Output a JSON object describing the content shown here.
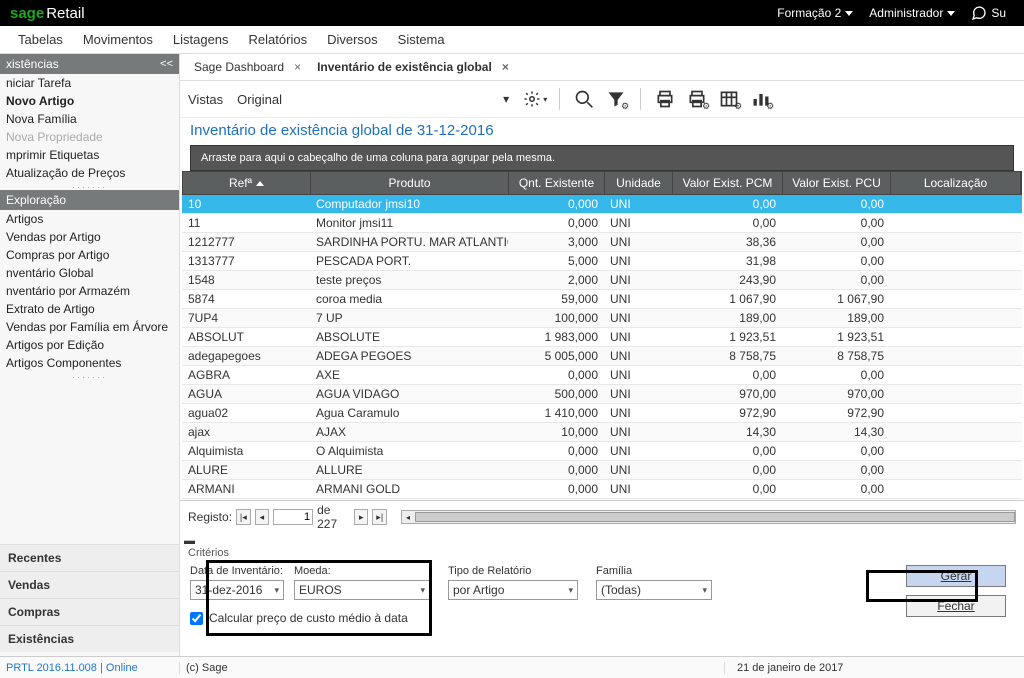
{
  "brand": {
    "sage": "sage",
    "retail": "Retail"
  },
  "topbar": {
    "formacao": "Formação 2",
    "admin": "Administrador",
    "su": "Su"
  },
  "menus": [
    "Tabelas",
    "Movimentos",
    "Listagens",
    "Relatórios",
    "Diversos",
    "Sistema"
  ],
  "sidebar": {
    "header": "xistências",
    "collapse": "<<",
    "items": [
      {
        "label": "niciar Tarefa"
      },
      {
        "label": "Novo Artigo",
        "bold": true
      },
      {
        "label": "Nova Família"
      },
      {
        "label": "Nova Propriedade",
        "dim": true
      },
      {
        "label": "mprimir Etiquetas"
      },
      {
        "label": "Atualização de Preços"
      }
    ],
    "explHeader": "Exploração",
    "explItems": [
      "Artigos",
      "Vendas por Artigo",
      "Compras por Artigo",
      "nventário Global",
      "nventário por Armazém",
      "Extrato de Artigo",
      "Vendas por Família em Árvore",
      "Artigos por Edição",
      "Artigos Componentes"
    ],
    "sections": [
      "Recentes",
      "Vendas",
      "Compras",
      "Existências"
    ]
  },
  "tabs": [
    {
      "label": "Sage Dashboard",
      "active": false
    },
    {
      "label": "Inventário de existência global",
      "active": true
    }
  ],
  "toolbar": {
    "vistas": "Vistas",
    "original": "Original"
  },
  "pageTitle": "Inventário de existência global de 31-12-2016",
  "groupHint": "Arraste para aqui o cabeçalho de uma coluna para agrupar pela mesma.",
  "columns": [
    "Refª",
    "Produto",
    "Qnt. Existente",
    "Unidade",
    "Valor Exist. PCM",
    "Valor Exist. PCU",
    "Localização"
  ],
  "rows": [
    {
      "ref": "10",
      "prod": "Computador jmsi10",
      "qnt": "0,000",
      "uni": "UNI",
      "pcm": "0,00",
      "pcu": "0,00",
      "sel": true
    },
    {
      "ref": "11",
      "prod": "Monitor jmsi11",
      "qnt": "0,000",
      "uni": "UNI",
      "pcm": "0,00",
      "pcu": "0,00"
    },
    {
      "ref": "1212777",
      "prod": "SARDINHA PORTU. MAR ATLANTIC",
      "qnt": "3,000",
      "uni": "UNI",
      "pcm": "38,36",
      "pcu": "0,00"
    },
    {
      "ref": "1313777",
      "prod": "PESCADA PORT.",
      "qnt": "5,000",
      "uni": "UNI",
      "pcm": "31,98",
      "pcu": "0,00"
    },
    {
      "ref": "1548",
      "prod": "teste preços",
      "qnt": "2,000",
      "uni": "UNI",
      "pcm": "243,90",
      "pcu": "0,00"
    },
    {
      "ref": "5874",
      "prod": "coroa media",
      "qnt": "59,000",
      "uni": "UNI",
      "pcm": "1 067,90",
      "pcu": "1 067,90"
    },
    {
      "ref": "7UP4",
      "prod": "7 UP",
      "qnt": "100,000",
      "uni": "UNI",
      "pcm": "189,00",
      "pcu": "189,00"
    },
    {
      "ref": "ABSOLUT",
      "prod": "ABSOLUTE",
      "qnt": "1 983,000",
      "uni": "UNI",
      "pcm": "1 923,51",
      "pcu": "1 923,51"
    },
    {
      "ref": "adegapegoes",
      "prod": "ADEGA PEGOES",
      "qnt": "5 005,000",
      "uni": "UNI",
      "pcm": "8 758,75",
      "pcu": "8 758,75"
    },
    {
      "ref": "AGBRA",
      "prod": "AXE",
      "qnt": "0,000",
      "uni": "UNI",
      "pcm": "0,00",
      "pcu": "0,00"
    },
    {
      "ref": "AGUA",
      "prod": "AGUA VIDAGO",
      "qnt": "500,000",
      "uni": "UNI",
      "pcm": "970,00",
      "pcu": "970,00"
    },
    {
      "ref": "agua02",
      "prod": "Agua Caramulo",
      "qnt": "1 410,000",
      "uni": "UNI",
      "pcm": "972,90",
      "pcu": "972,90"
    },
    {
      "ref": "ajax",
      "prod": "AJAX",
      "qnt": "10,000",
      "uni": "UNI",
      "pcm": "14,30",
      "pcu": "14,30"
    },
    {
      "ref": "Alquimista",
      "prod": "O Alquimista",
      "qnt": "0,000",
      "uni": "UNI",
      "pcm": "0,00",
      "pcu": "0,00"
    },
    {
      "ref": "ALURE",
      "prod": "ALLURE",
      "qnt": "0,000",
      "uni": "UNI",
      "pcm": "0,00",
      "pcu": "0,00"
    },
    {
      "ref": "ARMANI",
      "prod": "ARMANI GOLD",
      "qnt": "0,000",
      "uni": "UNI",
      "pcm": "0,00",
      "pcu": "0,00"
    }
  ],
  "pager": {
    "label": "Registo:",
    "page": "1",
    "total": "de 227"
  },
  "criteria": {
    "sectionLabel": "Critérios",
    "dateLabel": "Data de Inventário:",
    "date": "31-dez-2016",
    "moedaLabel": "Moeda:",
    "moeda": "EUROS",
    "tipoLabel": "Tipo de Relatório",
    "tipo": "por Artigo",
    "famLabel": "Família",
    "fam": "(Todas)",
    "chk": "Calcular preço de custo médio à data",
    "gerar": "Gerar",
    "fechar": "Fechar"
  },
  "status": {
    "version": "PRTL 2016.11.008 | Online",
    "copy": "(c) Sage",
    "date": "21 de janeiro de 2017"
  }
}
